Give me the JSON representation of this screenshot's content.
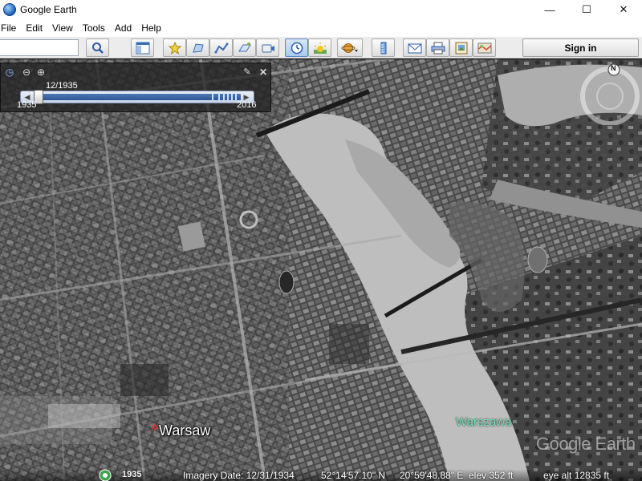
{
  "window": {
    "title": "Google Earth",
    "minimize_glyph": "—",
    "maximize_glyph": "☐",
    "close_glyph": "✕"
  },
  "menu": [
    "File",
    "Edit",
    "View",
    "Tools",
    "Add",
    "Help"
  ],
  "toolbar": {
    "search_value": "",
    "sign_in_label": "Sign in",
    "buttons": [
      "search-icon",
      "sidebar-icon",
      "placemark-icon",
      "polygon-icon",
      "path-icon",
      "image-overlay-icon",
      "tour-icon",
      "historical-imagery-icon",
      "sunlight-icon",
      "planets-icon",
      "ruler-icon",
      "email-icon",
      "print-icon",
      "save-image-icon",
      "maps-icon"
    ]
  },
  "time_slider": {
    "current_date": "12/1935",
    "start_year": "1935",
    "end_year": "2016",
    "zoom_out_glyph": "⊖",
    "zoom_in_glyph": "⊕",
    "settings_glyph": "🔧",
    "close_glyph": "✕",
    "position": 0.06
  },
  "compass": {
    "north_label": "N"
  },
  "map": {
    "place_label": "Warsaw",
    "district_label": "Warszawa",
    "watermark": "Google Earth"
  },
  "status": {
    "year": "1935",
    "imagery_date": "Imagery Date: 12/31/1934",
    "latitude": "52°14'57.10\" N",
    "longitude": "20°59'48.88\" E",
    "elevation": "elev  352 ft",
    "eye_alt": "eye alt  12835 ft"
  }
}
